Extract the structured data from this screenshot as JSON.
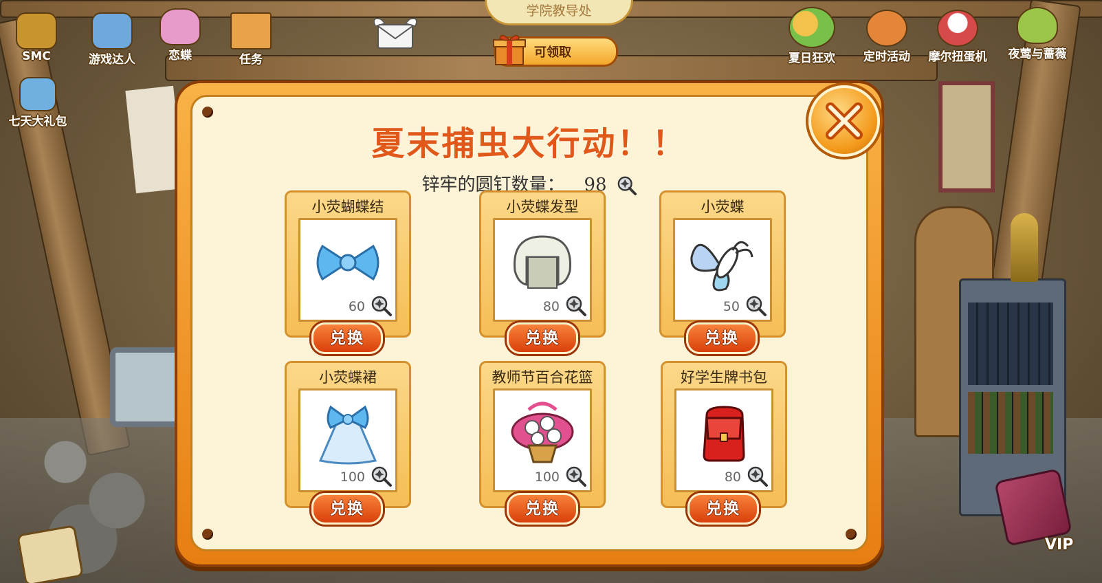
{
  "top_left_icons": [
    {
      "id": "smc",
      "label": "SMC",
      "color": "#c8942e"
    },
    {
      "id": "game-master",
      "label": "游戏达人",
      "color": "#6fa8dc"
    },
    {
      "id": "butterfly",
      "label": "恋蝶",
      "color": "#e89acb"
    },
    {
      "id": "tasks",
      "label": "任务",
      "color": "#e8a24a"
    }
  ],
  "gift_pack": {
    "label": "七天大礼包"
  },
  "office_sign": "学院教导处",
  "claim_button": "可领取",
  "top_right_icons": [
    {
      "id": "summer-carnival",
      "label": "夏日狂欢",
      "color": "#78c04a"
    },
    {
      "id": "timed-event",
      "label": "定时活动",
      "color": "#e4863a"
    },
    {
      "id": "gacha",
      "label": "摩尔扭蛋机",
      "color": "#d64a4a"
    },
    {
      "id": "nightingale",
      "label": "夜莺与蔷薇",
      "color": "#9bc64a"
    }
  ],
  "dialog": {
    "title": "夏末捕虫大行动！！",
    "count_label": "锌牢的圆钉数量：",
    "count_value": "98",
    "redeem_label": "兑换",
    "items": [
      {
        "name": "小荧蝴蝶结",
        "cost": "60",
        "color": "#5db8f0",
        "kind": "bow"
      },
      {
        "name": "小荧蝶发型",
        "cost": "80",
        "color": "#eef0e4",
        "kind": "hair"
      },
      {
        "name": "小荧蝶",
        "cost": "50",
        "color": "#9fd6ef",
        "kind": "butterfly"
      },
      {
        "name": "小荧蝶裙",
        "cost": "100",
        "color": "#9ad2f5",
        "kind": "dress"
      },
      {
        "name": "教师节百合花篮",
        "cost": "100",
        "color": "#e2508f",
        "kind": "basket"
      },
      {
        "name": "好学生牌书包",
        "cost": "80",
        "color": "#d8201c",
        "kind": "bag"
      }
    ]
  },
  "vip_label": "VIP",
  "colors": {
    "accent": "#e1581b",
    "panel": "#fdf4d8",
    "frame": "#f39a1b",
    "button": "#d9400b"
  }
}
